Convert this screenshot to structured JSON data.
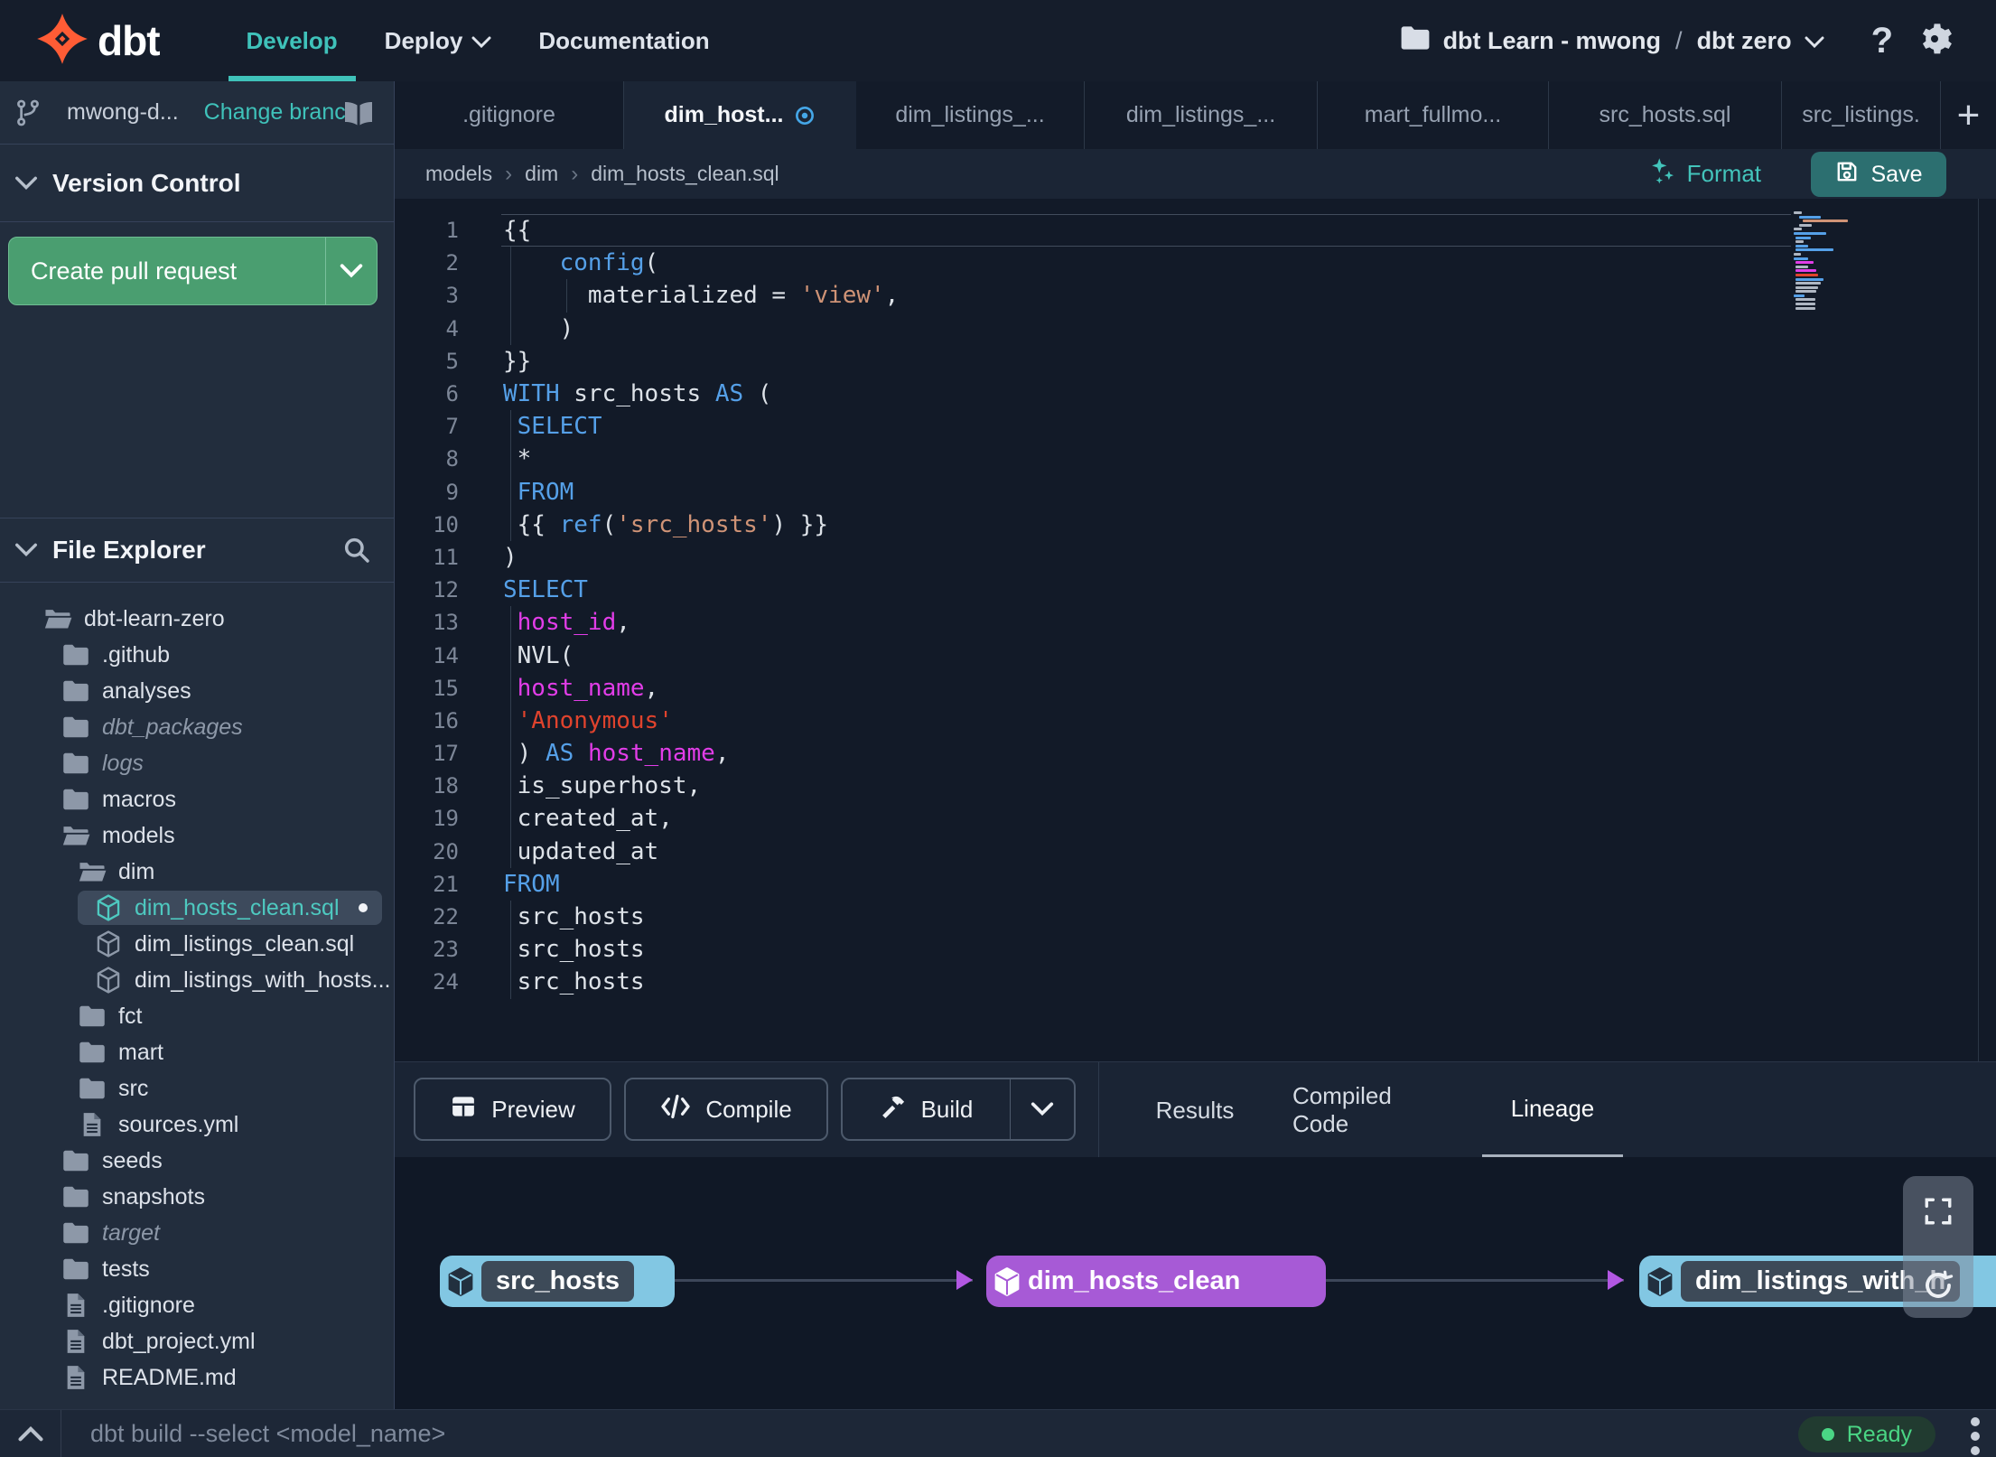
{
  "nav": {
    "brand": "dbt",
    "items": [
      {
        "label": "Develop",
        "active": true
      },
      {
        "label": "Deploy",
        "has_dropdown": true
      },
      {
        "label": "Documentation"
      }
    ],
    "project": {
      "account": "dbt Learn - mwong",
      "separator": "/",
      "name": "dbt zero"
    }
  },
  "sidebar": {
    "branch": {
      "name": "mwong-d...",
      "change_label": "Change branch"
    },
    "version_control": {
      "title": "Version Control",
      "create_pr_label": "Create pull request"
    },
    "file_explorer": {
      "title": "File Explorer",
      "tree": [
        {
          "label": "dbt-learn-zero",
          "icon": "folder-open-icon",
          "level": 0
        },
        {
          "label": ".github",
          "icon": "folder-icon",
          "level": 1
        },
        {
          "label": "analyses",
          "icon": "folder-icon",
          "level": 1
        },
        {
          "label": "dbt_packages",
          "icon": "folder-icon",
          "level": 1,
          "italic": true
        },
        {
          "label": "logs",
          "icon": "folder-icon",
          "level": 1,
          "italic": true
        },
        {
          "label": "macros",
          "icon": "folder-icon",
          "level": 1
        },
        {
          "label": "models",
          "icon": "folder-open-icon",
          "level": 1
        },
        {
          "label": "dim",
          "icon": "folder-open-icon",
          "level": 2
        },
        {
          "label": "dim_hosts_clean.sql",
          "icon": "model-icon",
          "level": 3,
          "selected": true,
          "modified": true
        },
        {
          "label": "dim_listings_clean.sql",
          "icon": "model-icon",
          "level": 3
        },
        {
          "label": "dim_listings_with_hosts...",
          "icon": "model-icon",
          "level": 3
        },
        {
          "label": "fct",
          "icon": "folder-icon",
          "level": 2
        },
        {
          "label": "mart",
          "icon": "folder-icon",
          "level": 2
        },
        {
          "label": "src",
          "icon": "folder-icon",
          "level": 2
        },
        {
          "label": "sources.yml",
          "icon": "file-icon",
          "level": 2
        },
        {
          "label": "seeds",
          "icon": "folder-icon",
          "level": 1
        },
        {
          "label": "snapshots",
          "icon": "folder-icon",
          "level": 1
        },
        {
          "label": "target",
          "icon": "folder-icon",
          "level": 1,
          "italic": true
        },
        {
          "label": "tests",
          "icon": "folder-icon",
          "level": 1
        },
        {
          "label": ".gitignore",
          "icon": "file-icon",
          "level": 1
        },
        {
          "label": "dbt_project.yml",
          "icon": "file-icon",
          "level": 1
        },
        {
          "label": "README.md",
          "icon": "file-icon",
          "level": 1
        }
      ]
    }
  },
  "tabs": [
    {
      "label": ".gitignore"
    },
    {
      "label": "dim_host...",
      "active": true,
      "modified": true
    },
    {
      "label": "dim_listings_..."
    },
    {
      "label": "dim_listings_..."
    },
    {
      "label": "mart_fullmo..."
    },
    {
      "label": "src_hosts.sql"
    },
    {
      "label": "src_listings."
    }
  ],
  "editor": {
    "breadcrumb": [
      "models",
      "dim",
      "dim_hosts_clean.sql"
    ],
    "format_label": "Format",
    "save_label": "Save",
    "lines": [
      {
        "n": 1,
        "current": true,
        "tokens": [
          [
            "{{",
            "p"
          ]
        ]
      },
      {
        "n": 2,
        "tokens": [
          [
            "    ",
            "p"
          ],
          [
            "config",
            "k"
          ],
          [
            "(",
            "p"
          ]
        ]
      },
      {
        "n": 3,
        "tokens": [
          [
            "      materialized = ",
            "p"
          ],
          [
            "'view'",
            "s"
          ],
          [
            ",",
            "p"
          ]
        ]
      },
      {
        "n": 4,
        "tokens": [
          [
            "    )",
            "p"
          ]
        ]
      },
      {
        "n": 5,
        "tokens": [
          [
            "}}",
            "p"
          ]
        ]
      },
      {
        "n": 6,
        "tokens": [
          [
            "WITH",
            "k"
          ],
          [
            " src_hosts ",
            "p"
          ],
          [
            "AS",
            "k"
          ],
          [
            " (",
            "p"
          ]
        ]
      },
      {
        "n": 7,
        "tokens": [
          [
            " ",
            "p"
          ],
          [
            "SELECT",
            "k"
          ]
        ]
      },
      {
        "n": 8,
        "tokens": [
          [
            " *",
            "p"
          ]
        ]
      },
      {
        "n": 9,
        "tokens": [
          [
            " ",
            "p"
          ],
          [
            "FROM",
            "k"
          ]
        ]
      },
      {
        "n": 10,
        "tokens": [
          [
            " {{ ",
            "p"
          ],
          [
            "ref",
            "k"
          ],
          [
            "(",
            "p"
          ],
          [
            "'src_hosts'",
            "s"
          ],
          [
            ") }}",
            "p"
          ]
        ]
      },
      {
        "n": 11,
        "tokens": [
          [
            ")",
            "p"
          ]
        ]
      },
      {
        "n": 12,
        "tokens": [
          [
            "SELECT",
            "k"
          ]
        ]
      },
      {
        "n": 13,
        "tokens": [
          [
            " ",
            "p"
          ],
          [
            "host_id",
            "m"
          ],
          [
            ",",
            "p"
          ]
        ]
      },
      {
        "n": 14,
        "tokens": [
          [
            " NVL(",
            "p"
          ]
        ]
      },
      {
        "n": 15,
        "tokens": [
          [
            " ",
            "p"
          ],
          [
            "host_name",
            "m"
          ],
          [
            ",",
            "p"
          ]
        ]
      },
      {
        "n": 16,
        "tokens": [
          [
            " ",
            "p"
          ],
          [
            "'Anonymous'",
            "r"
          ]
        ]
      },
      {
        "n": 17,
        "tokens": [
          [
            " ) ",
            "p"
          ],
          [
            "AS",
            "k"
          ],
          [
            " ",
            "p"
          ],
          [
            "host_name",
            "m"
          ],
          [
            ",",
            "p"
          ]
        ]
      },
      {
        "n": 18,
        "tokens": [
          [
            " is_superhost,",
            "p"
          ]
        ]
      },
      {
        "n": 19,
        "tokens": [
          [
            " created_at,",
            "p"
          ]
        ]
      },
      {
        "n": 20,
        "tokens": [
          [
            " updated_at",
            "p"
          ]
        ]
      },
      {
        "n": 21,
        "tokens": [
          [
            "FROM",
            "k"
          ]
        ]
      },
      {
        "n": 22,
        "tokens": [
          [
            " src_hosts",
            "p"
          ]
        ]
      },
      {
        "n": 23,
        "tokens": [
          [
            " src_hosts",
            "p"
          ]
        ]
      },
      {
        "n": 24,
        "tokens": [
          [
            " src_hosts",
            "p"
          ]
        ]
      }
    ],
    "indent_guides": [
      {
        "from": 2,
        "to": 4,
        "col": 0
      },
      {
        "from": 3,
        "to": 3,
        "col": 4
      },
      {
        "from": 7,
        "to": 10,
        "col": 0
      },
      {
        "from": 13,
        "to": 20,
        "col": 0
      },
      {
        "from": 22,
        "to": 24,
        "col": 0
      }
    ]
  },
  "bottom_panel": {
    "buttons": [
      {
        "label": "Preview",
        "icon": "table-icon"
      },
      {
        "label": "Compile",
        "icon": "code-icon"
      },
      {
        "label": "Build",
        "icon": "hammer-icon",
        "split": true
      }
    ],
    "tabs": [
      {
        "label": "Results"
      },
      {
        "label": "Compiled Code"
      },
      {
        "label": "Lineage",
        "active": true
      }
    ]
  },
  "lineage": {
    "nodes": [
      {
        "label": "src_hosts",
        "color": "cyan"
      },
      {
        "label": "dim_hosts_clean",
        "color": "purple"
      },
      {
        "label": "dim_listings_with_h",
        "color": "cyan"
      }
    ]
  },
  "command_bar": {
    "placeholder": "dbt build --select <model_name>",
    "status": "Ready"
  },
  "colors": {
    "accent_teal": "#3fc2ba",
    "pr_green": "#4a9e70",
    "save_teal": "#2c6f70",
    "node_cyan": "#82c7e3",
    "node_purple": "#a75ad6",
    "edge_arrow": "#b257e2",
    "ready_green": "#4ad584",
    "keyword_blue": "#55a0e8",
    "column_magenta": "#e23de8",
    "string_red": "#e0432d",
    "string_salmon": "#cf9376",
    "modified_blue": "#45a7e8"
  }
}
